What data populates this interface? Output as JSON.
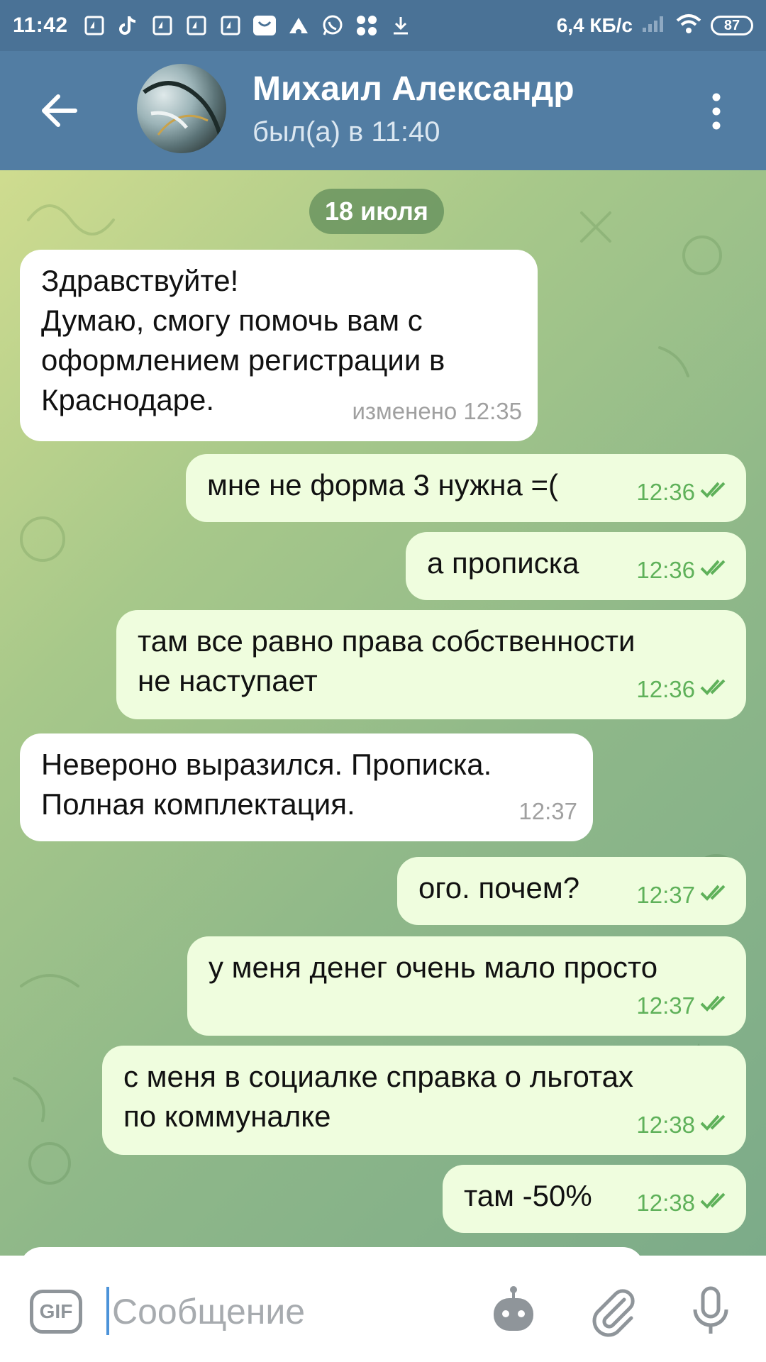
{
  "status_bar": {
    "time": "11:42",
    "speed": "6,4 КБ/с",
    "battery": "87"
  },
  "header": {
    "name": "Михаил Александр",
    "status": "был(а) в 11:40"
  },
  "date_label": "18 июля",
  "messages": [
    {
      "dir": "in",
      "text": "Здравствуйте!\nДумаю, смогу помочь вам с\nоформлением регистрации в\nКраснодаре.",
      "time": "изменено 12:35"
    },
    {
      "dir": "out",
      "text": "мне не форма 3 нужна =(",
      "time": "12:36"
    },
    {
      "dir": "out",
      "text": "а прописка",
      "time": "12:36"
    },
    {
      "dir": "out",
      "text": "там все равно права собственности\nне наступает",
      "time": "12:36"
    },
    {
      "dir": "in",
      "text": "Невероно выразился. Прописка.\nПолная комплектация.",
      "time": "12:37"
    },
    {
      "dir": "out",
      "text": "ого. почем?",
      "time": "12:37"
    },
    {
      "dir": "out",
      "text": "у меня денег очень мало просто",
      "time": "12:37"
    },
    {
      "dir": "out",
      "text": "с меня в социалке справка о льготах\nпо коммуналке",
      "time": "12:38"
    },
    {
      "dir": "out",
      "text": "там -50%",
      "time": "12:38"
    }
  ],
  "input": {
    "placeholder": "Сообщение",
    "gif_label": "GIF"
  },
  "colors": {
    "header": "#527da3",
    "outgoing_bubble": "#effdde",
    "incoming_bubble": "#ffffff",
    "read_ticks": "#5fb15a"
  },
  "icons": [
    "back-arrow-icon",
    "more-vertical-icon",
    "bot-icon",
    "attach-icon",
    "microphone-icon",
    "double-check-icon"
  ]
}
